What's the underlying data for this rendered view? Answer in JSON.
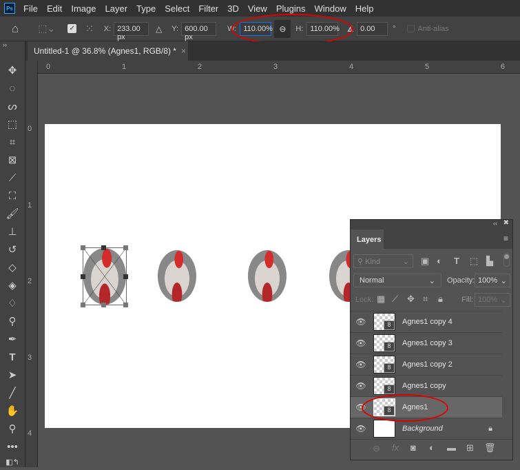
{
  "menu": [
    "File",
    "Edit",
    "Image",
    "Layer",
    "Type",
    "Select",
    "Filter",
    "3D",
    "View",
    "Plugins",
    "Window",
    "Help"
  ],
  "app_logo": "Ps",
  "options": {
    "x_label": "X:",
    "x_value": "233.00 px",
    "y_label": "Y:",
    "y_value": "600.00 px",
    "w_label": "W:",
    "w_value": "110.00%",
    "h_label": "H:",
    "h_value": "110.00%",
    "angle_value": "0.00",
    "degree": "°",
    "antialias": "Anti-alias"
  },
  "tab": {
    "title": "Untitled-1 @ 36.8% (Agnes1, RGB/8) *",
    "close": "×"
  },
  "rulers": {
    "h": [
      "0",
      "1",
      "2",
      "3",
      "4",
      "5",
      "6"
    ],
    "v": [
      "0",
      "1",
      "2",
      "3",
      "4"
    ]
  },
  "layers_panel": {
    "title": "Layers",
    "kind": "Kind",
    "blend": "Normal",
    "opacity_label": "Opacity:",
    "opacity": "100%",
    "lock_label": "Lock:",
    "fill_label": "Fill:",
    "fill": "100%",
    "layers": [
      {
        "name": "Agnes1 copy 4"
      },
      {
        "name": "Agnes1 copy 3"
      },
      {
        "name": "Agnes1 copy 2"
      },
      {
        "name": "Agnes1 copy"
      },
      {
        "name": "Agnes1",
        "selected": true
      },
      {
        "name": "Background",
        "locked": true
      }
    ]
  },
  "annotation_color": "#e00000"
}
